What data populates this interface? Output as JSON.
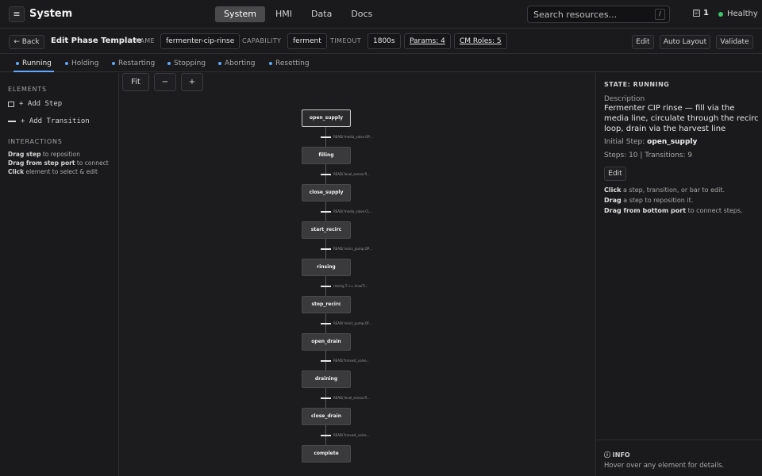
{
  "app": {
    "title": "System",
    "menu_icon": "≡"
  },
  "nav": {
    "tabs": [
      "System",
      "HMI",
      "Data",
      "Docs"
    ],
    "active": "System"
  },
  "search": {
    "placeholder": "Search resources...",
    "shortcut": "/"
  },
  "status": {
    "tasks_count": "1",
    "tasks_icon": "☑",
    "health": "Healthy",
    "health_color": "#3bc46a"
  },
  "toolbar": {
    "back_label": "← Back",
    "title": "Edit Phase Template",
    "name_label": "NAME",
    "name_value": "fermenter-cip-rinse",
    "capability_label": "CAPABILITY",
    "capability_value": "ferment",
    "timeout_label": "TIMEOUT",
    "timeout_value": "1800s",
    "params_label": "Params: 4",
    "cm_roles_label": "CM Roles: 5",
    "edit_label": "Edit",
    "auto_layout_label": "Auto Layout",
    "validate_label": "Validate"
  },
  "phase_tabs": [
    "Running",
    "Holding",
    "Restarting",
    "Stopping",
    "Aborting",
    "Resetting"
  ],
  "active_phase": "Running",
  "accent_color": "#5fa8ff",
  "left_panel": {
    "elements_heading": "ELEMENTS",
    "add_step": "+ Add Step",
    "add_transition": "+ Add Transition",
    "interactions_heading": "INTERACTIONS",
    "help": [
      {
        "bold": "Drag step",
        "rest": " to reposition"
      },
      {
        "bold": "Drag from step port",
        "rest": " to connect"
      },
      {
        "bold": "Click",
        "rest": " element to select & edit"
      }
    ]
  },
  "canvas": {
    "zoom_fit": "Fit",
    "zoom_out": "−",
    "zoom_in": "+",
    "steps": [
      "open_supply",
      "filling",
      "close_supply",
      "start_recirc",
      "rinsing",
      "stop_recirc",
      "open_drain",
      "draining",
      "close_drain",
      "complete"
    ],
    "transitions": [
      "READ('media_valve.OP…",
      "READ('level_sensor.fl…",
      "READ('media_valve.CL…",
      "READ('recirc_pump.OP…",
      "rinsing.T >= rinseTi…",
      "READ('recirc_pump.OF…",
      "READ('harvest_valve…",
      "READ('level_sensor.fl…",
      "READ('harvest_valve…"
    ]
  },
  "right_panel": {
    "state_title": "STATE: RUNNING",
    "description_label": "Description",
    "description": "Fermenter CIP rinse — fill via the media line, circulate through the recirc loop, drain via the harvest line",
    "initial_step_label": "Initial Step: ",
    "initial_step": "open_supply",
    "counts": "Steps: 10 | Transitions: 9",
    "edit_label": "Edit",
    "help": [
      {
        "bold": "Click",
        "rest": " a step, transition, or bar to edit."
      },
      {
        "bold": "Drag",
        "rest": " a step to reposition it."
      },
      {
        "bold": "Drag from bottom port",
        "rest": " to connect steps."
      }
    ],
    "info_title": "ⓘ INFO",
    "info_text": "Hover over any element for details."
  }
}
